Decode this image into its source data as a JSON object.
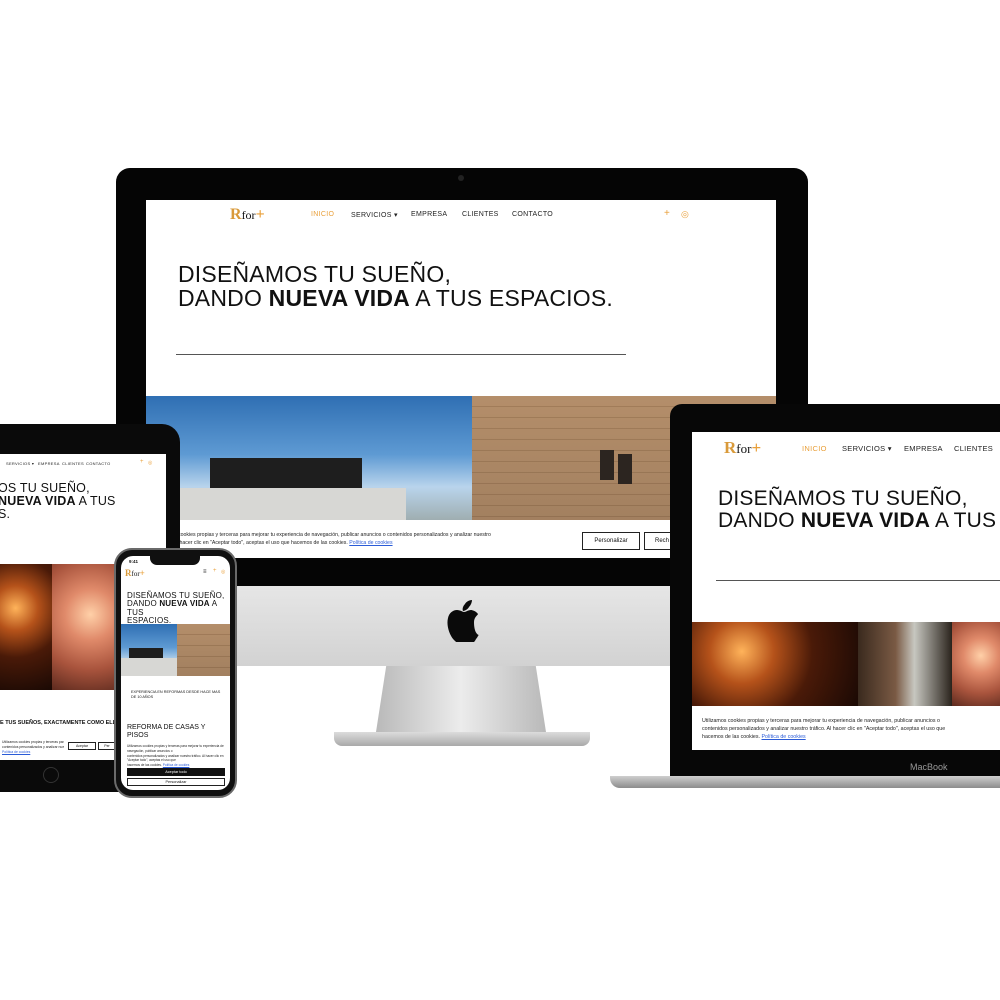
{
  "site": {
    "brand_r": "R",
    "brand_for": "for",
    "brand_plus": "+",
    "nav": [
      "INICIO",
      "SERVICIOS ▾",
      "EMPRESA",
      "CLIENTES",
      "CONTACTO"
    ],
    "plus_symbol": "+",
    "instagram_symbol": "◎",
    "hero_line1": "DISEÑAMOS TU SUEÑO,",
    "hero_line2_a": "DANDO ",
    "hero_line2_b": "NUEVA VIDA",
    "hero_line2_c": " A TUS ESPACIOS.",
    "hero_line2_c_short": " A TUS",
    "hero_line3": "ESPACIOS."
  },
  "cookies": {
    "imac_text_a": "s cookies propias y terceras para mejorar tu experiencia de navegación, publicar anuncios o contenidos personalizados y analizar nuestro",
    "imac_text_b": "al hacer clic en \"Aceptar todo\", aceptas el uso que hacemos de las cookies.",
    "link": "Política de cookies",
    "btn_personalizar": "Personalizar",
    "btn_rechazar_cut": "Rech",
    "mb_text_a": "Utilizamos cookies propias y terceras para mejorar tu experiencia de navegación, publicar anuncios o",
    "mb_text_b": "contenidos personalizados y analizar nuestro tráfico. Al hacer clic en \"Aceptar todo\", aceptas el uso que",
    "mb_text_c": "hacemos de las cookies.",
    "btn_aceptar": "Aceptar"
  },
  "macbook": {
    "label": "MacBook"
  },
  "ipad": {
    "hero_a": "OS TU SUEÑO,",
    "hero_b_bold": "NUEVA VIDA",
    "hero_b_rest": " A TUS",
    "hero_c": "S.",
    "tagline": "E TUS SUEÑOS, EXACTAMENTE COMO ELLA",
    "btn_a": "Aceptar",
    "btn_b": "Per"
  },
  "iphone": {
    "time": "9:41",
    "menu_symbol": "≡",
    "caption": "EXPERIENCIA EN REFORMAS DESDE HACE MAS DE 10 AÑOS",
    "section_title": "REFORMA DE CASAS Y PISOS",
    "btn_aceptar": "Aceptar todo",
    "btn_personalizar": "Personalizar"
  }
}
